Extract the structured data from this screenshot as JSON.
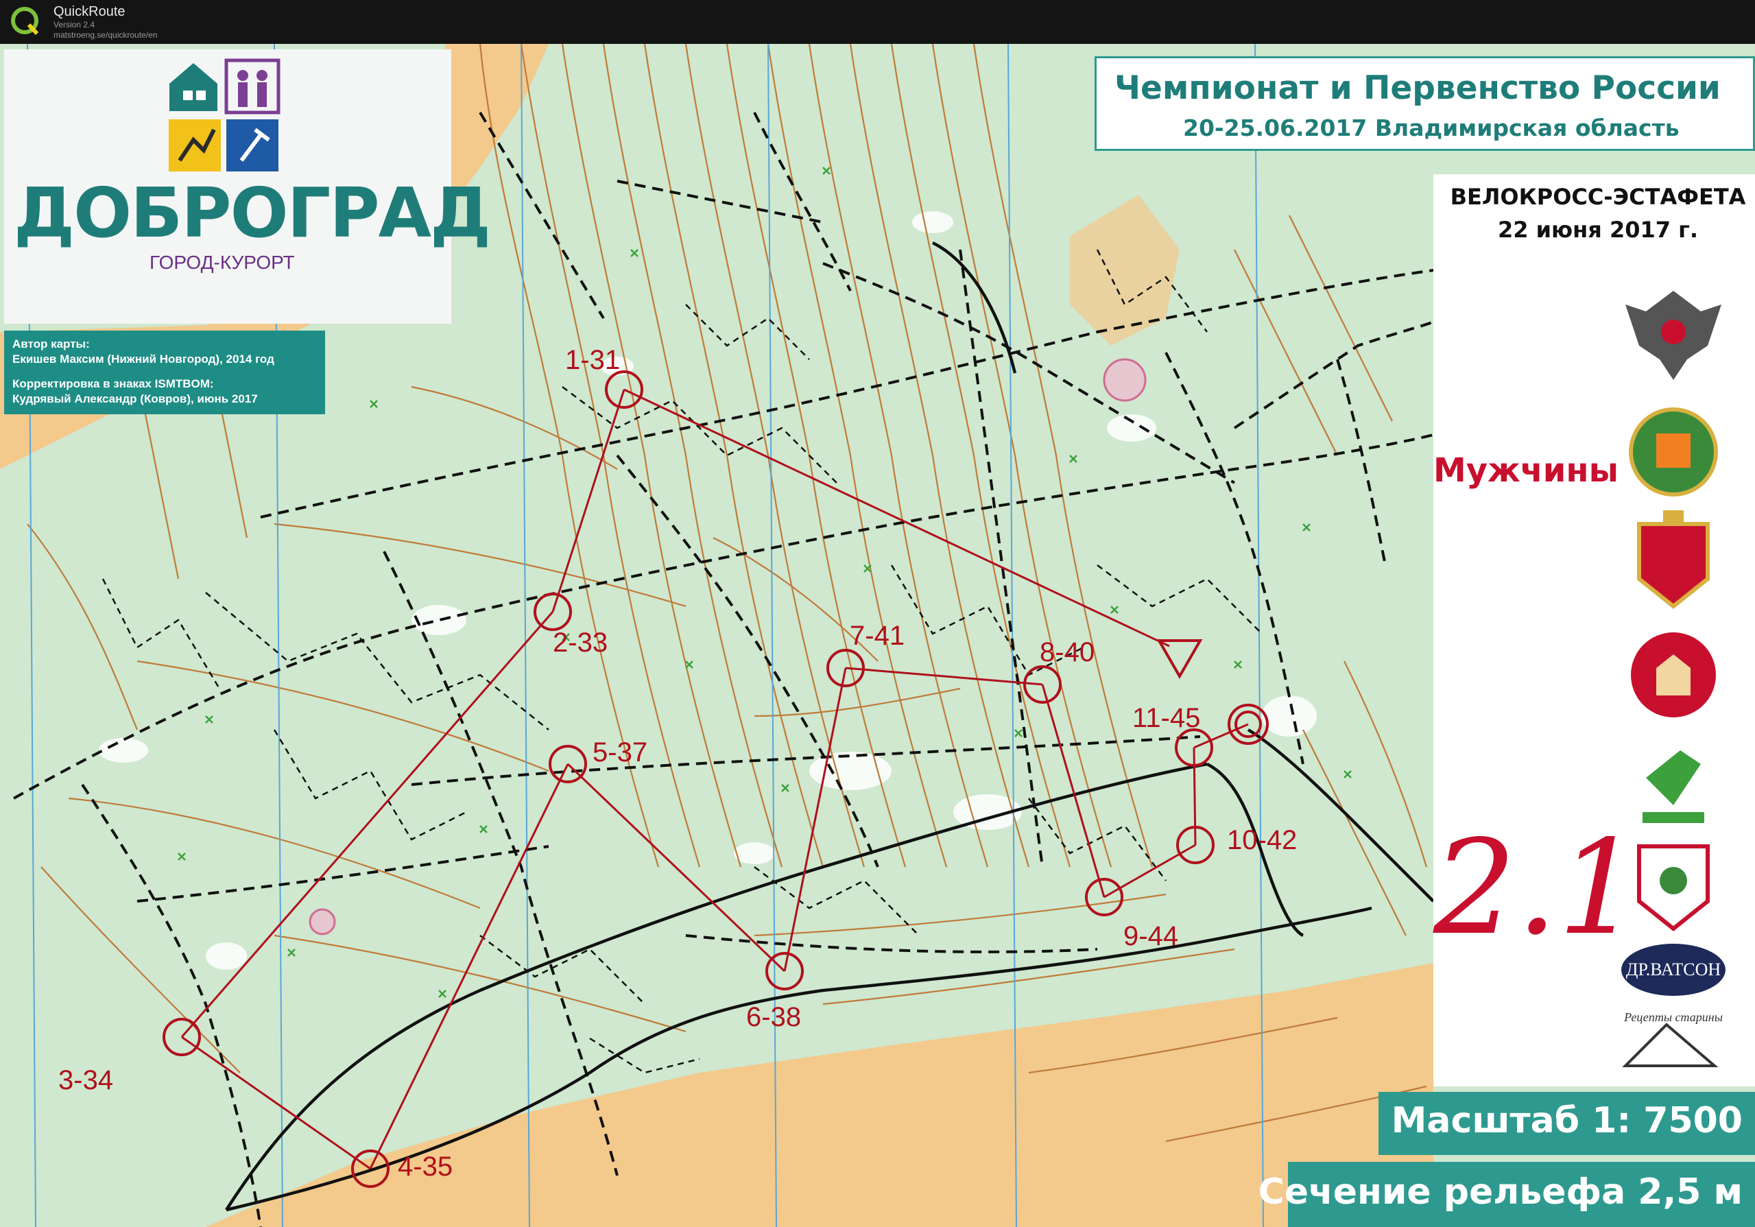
{
  "app": {
    "name": "QuickRoute",
    "version": "Version 2.4",
    "url": "matstroeng.se/quickroute/en"
  },
  "brand": {
    "name": "ДОБРОГРАД",
    "subtitle": "ГОРОД-КУРОРТ"
  },
  "credits": {
    "author_label": "Автор карты:",
    "author": "Екишев Максим (Нижний Новгород), 2014 год",
    "correction_label": "Корректировка в знаках ISMTBOM:",
    "correction": "Кудрявый Александр (Ковров), июнь 2017"
  },
  "event": {
    "title": "Чемпионат и Первенство России",
    "date_place": "20-25.06.2017 Владимирская область"
  },
  "race": {
    "name": "ВЕЛОКРОСС-ЭСТАФЕТА",
    "date": "22 июня 2017 г.",
    "category": "Мужчины",
    "leg": "2.1"
  },
  "sponsors": {
    "watson": "ДР.ВАТСОН",
    "recipes": "Рецепты старины"
  },
  "map_info": {
    "scale": "Масштаб 1: 7500",
    "contour": "Сечение рельефа 2,5 м"
  },
  "controls": [
    {
      "label": "1-31"
    },
    {
      "label": "2-33"
    },
    {
      "label": "3-34"
    },
    {
      "label": "4-35"
    },
    {
      "label": "5-37"
    },
    {
      "label": "6-38"
    },
    {
      "label": "7-41"
    },
    {
      "label": "8-40"
    },
    {
      "label": "9-44"
    },
    {
      "label": "10-42"
    },
    {
      "label": "11-45"
    }
  ],
  "colors": {
    "forest": "#cfe8cf",
    "open": "#f3c98c",
    "contour": "#c07a3a",
    "course": "#b0101c",
    "teal": "#2e9a8f",
    "brand_teal": "#1f7d79"
  }
}
